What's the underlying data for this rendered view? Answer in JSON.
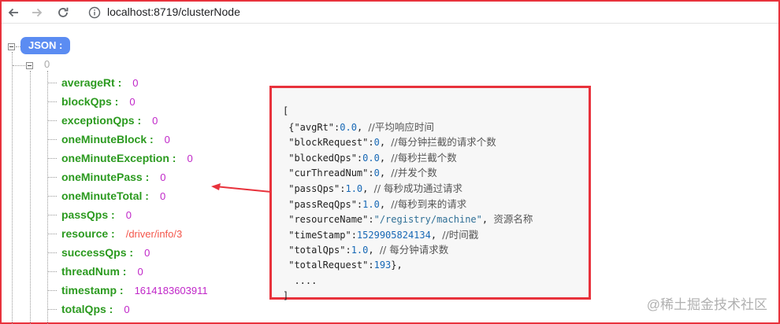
{
  "browser": {
    "url": "localhost:8719/clusterNode"
  },
  "tree": {
    "root_label": "JSON :",
    "index_label": "0",
    "rows": [
      {
        "key": "averageRt :",
        "value": "0",
        "type": "num"
      },
      {
        "key": "blockQps :",
        "value": "0",
        "type": "num"
      },
      {
        "key": "exceptionQps :",
        "value": "0",
        "type": "num"
      },
      {
        "key": "oneMinuteBlock :",
        "value": "0",
        "type": "num"
      },
      {
        "key": "oneMinuteException :",
        "value": "0",
        "type": "num"
      },
      {
        "key": "oneMinutePass :",
        "value": "0",
        "type": "num"
      },
      {
        "key": "oneMinuteTotal :",
        "value": "0",
        "type": "num"
      },
      {
        "key": "passQps :",
        "value": "0",
        "type": "num"
      },
      {
        "key": "resource :",
        "value": "/driver/info/3",
        "type": "str"
      },
      {
        "key": "successQps :",
        "value": "0",
        "type": "num"
      },
      {
        "key": "threadNum :",
        "value": "0",
        "type": "num"
      },
      {
        "key": "timestamp :",
        "value": "1614183603911",
        "type": "num"
      },
      {
        "key": "totalQps :",
        "value": "0",
        "type": "num"
      }
    ]
  },
  "annotation": {
    "lines": [
      {
        "code": "[",
        "num": "",
        "tail": "",
        "comment": ""
      },
      {
        "code": " {\"avgRt\":",
        "num": "0.0",
        "tail": ", ",
        "comment": "//平均响应时间"
      },
      {
        "code": " \"blockRequest\":",
        "num": "0",
        "tail": ", ",
        "comment": "//每分钟拦截的请求个数"
      },
      {
        "code": " \"blockedQps\":",
        "num": "0.0",
        "tail": ", ",
        "comment": "//每秒拦截个数"
      },
      {
        "code": " \"curThreadNum\":",
        "num": "0",
        "tail": ", ",
        "comment": "//并发个数"
      },
      {
        "code": " \"passQps\":",
        "num": "1.0",
        "tail": ", ",
        "comment": "// 每秒成功通过请求"
      },
      {
        "code": " \"passReqQps\":",
        "num": "1.0",
        "tail": ", ",
        "comment": "//每秒到来的请求"
      },
      {
        "code": " \"resourceName\":",
        "num": "\"/registry/machine\"",
        "tail": ", ",
        "comment": "资源名称"
      },
      {
        "code": " \"timeStamp\":",
        "num": "1529905824134",
        "tail": ", ",
        "comment": "//时间戳"
      },
      {
        "code": " \"totalQps\":",
        "num": "1.0",
        "tail": ", ",
        "comment": "// 每分钟请求数"
      },
      {
        "code": " \"totalRequest\":",
        "num": "193",
        "tail": "},",
        "comment": ""
      },
      {
        "code": "  ....",
        "num": "",
        "tail": "",
        "comment": ""
      },
      {
        "code": "]",
        "num": "",
        "tail": "",
        "comment": ""
      }
    ]
  },
  "watermark": "@稀土掘金技术社区",
  "colors": {
    "key": "#2b9a1f",
    "number": "#c026c8",
    "string": "#f4554a",
    "badge": "#5b8cf2",
    "highlight": "#e8323c"
  }
}
